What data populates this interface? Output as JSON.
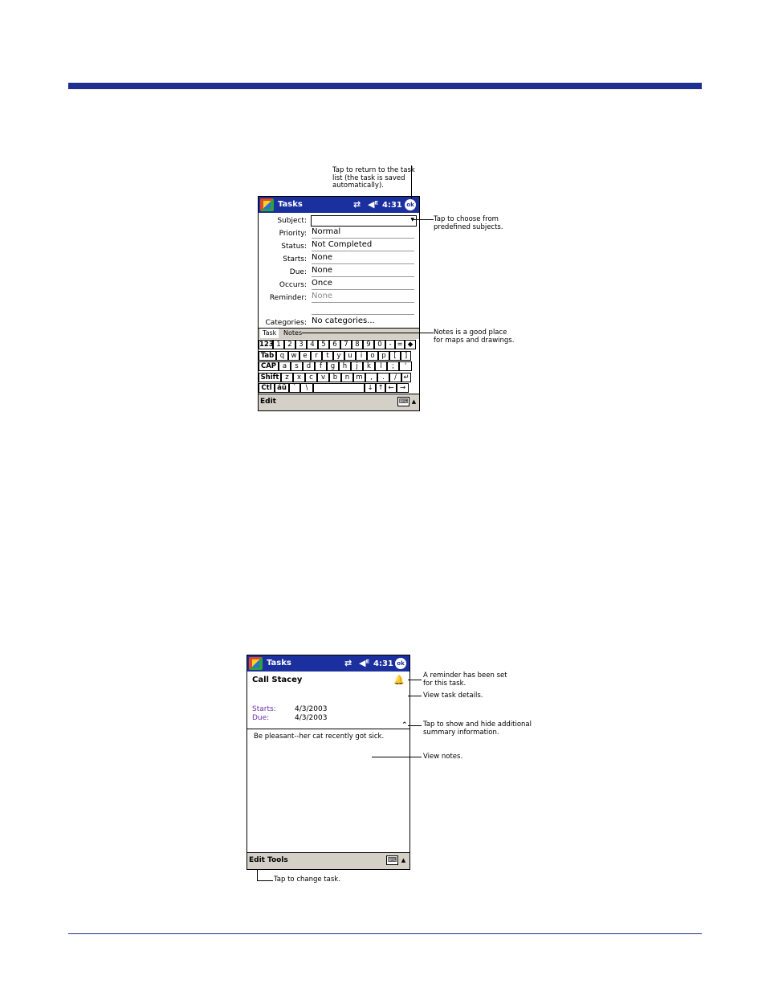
{
  "colors": {
    "rule": "#1f2e8f",
    "titlebar": "#1c2f9e",
    "label_purple": "#6b2fa6"
  },
  "screen1": {
    "title": "Tasks",
    "time": "4:31",
    "ok": "ok",
    "sync_icon": "⇄",
    "speaker_icon": "◀ᴱ",
    "fields": [
      {
        "label": "Subject:",
        "value": ""
      },
      {
        "label": "Priority:",
        "value": "Normal"
      },
      {
        "label": "Status:",
        "value": "Not Completed"
      },
      {
        "label": "Starts:",
        "value": "None"
      },
      {
        "label": "Due:",
        "value": "None"
      },
      {
        "label": "Occurs:",
        "value": "Once"
      },
      {
        "label": "Reminder:",
        "value": "None"
      },
      {
        "label": "Categories:",
        "value": "No categories..."
      }
    ],
    "tabs": [
      "Task",
      "Notes"
    ],
    "keyboard": {
      "row1": [
        "123",
        "1",
        "2",
        "3",
        "4",
        "5",
        "6",
        "7",
        "8",
        "9",
        "0",
        "-",
        "=",
        "◆"
      ],
      "row2": [
        "Tab",
        "q",
        "w",
        "e",
        "r",
        "t",
        "y",
        "u",
        "i",
        "o",
        "p",
        "[",
        "]"
      ],
      "row3": [
        "CAP",
        "a",
        "s",
        "d",
        "f",
        "g",
        "h",
        "j",
        "k",
        "l",
        ";",
        "'"
      ],
      "row4": [
        "Shift",
        "z",
        "x",
        "c",
        "v",
        "b",
        "n",
        "m",
        ",",
        ".",
        "/",
        "↵"
      ],
      "row5": [
        "Ctl",
        "áü",
        "`",
        "\\",
        "",
        "↓",
        "↑",
        "←",
        "→"
      ]
    },
    "command": "Edit",
    "kbd_icon": "⌨",
    "up_arrow": "▲"
  },
  "screen2": {
    "title": "Tasks",
    "time": "4:31",
    "ok": "ok",
    "sync_icon": "⇄",
    "speaker_icon": "◀ᴱ",
    "task_name": "Call Stacey",
    "bell_icon": "🔔",
    "starts_label": "Starts:",
    "starts_value": "4/3/2003",
    "due_label": "Due:",
    "due_value": "4/3/2003",
    "chevron": "⌃",
    "note": "Be pleasant--her cat recently got sick.",
    "commands": [
      "Edit",
      "Tools"
    ],
    "kbd_icon": "⌨",
    "up_arrow": "▲"
  },
  "callouts": {
    "c1": "Tap to return to the task\nlist (the task is saved\nautomatically).",
    "c2": "Tap to choose from\npredefined subjects.",
    "c3": "Notes is a good place\nfor maps and drawings.",
    "c4": "A reminder has been set\nfor this task.",
    "c5": "View task details.",
    "c6": "Tap to show and hide additional\nsummary information.",
    "c7": "View notes.",
    "c8": "Tap to change task."
  }
}
